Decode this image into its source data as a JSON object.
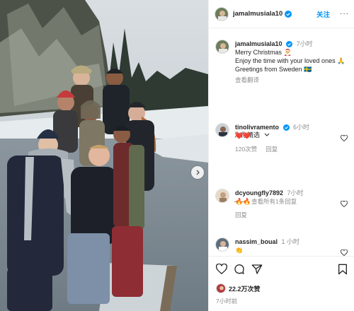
{
  "header": {
    "username": "jamalmusiala10",
    "follow_label": "关注",
    "more_glyph": "···"
  },
  "caption": {
    "username": "jamalmusiala10",
    "time": "7小时",
    "lines": [
      "Merry Christmas 🎅",
      "Enjoy the time with your loved ones 🙏",
      "Greetings from Sweden 🇸🇪"
    ],
    "see_translation": "查看翻译"
  },
  "comment_filter": "为你精选",
  "comments": [
    {
      "username": "tinolivramento",
      "time": "6小时",
      "text": "❤️❤️",
      "likes": "120次赞",
      "reply": "回复",
      "view_replies": "查看所有1条回复"
    },
    {
      "username": "dcyoungfly7892",
      "time": "7小时",
      "text": "🔥🔥",
      "reply": "回复"
    },
    {
      "username": "nassim_boual",
      "time": "1 小时",
      "text": "👏"
    }
  ],
  "footer": {
    "likes": "22.2万次赞",
    "time": "7小时前"
  },
  "colors": {
    "accent": "#0095f6",
    "verified": "#0095f6",
    "heart_red": "#ed4956"
  }
}
